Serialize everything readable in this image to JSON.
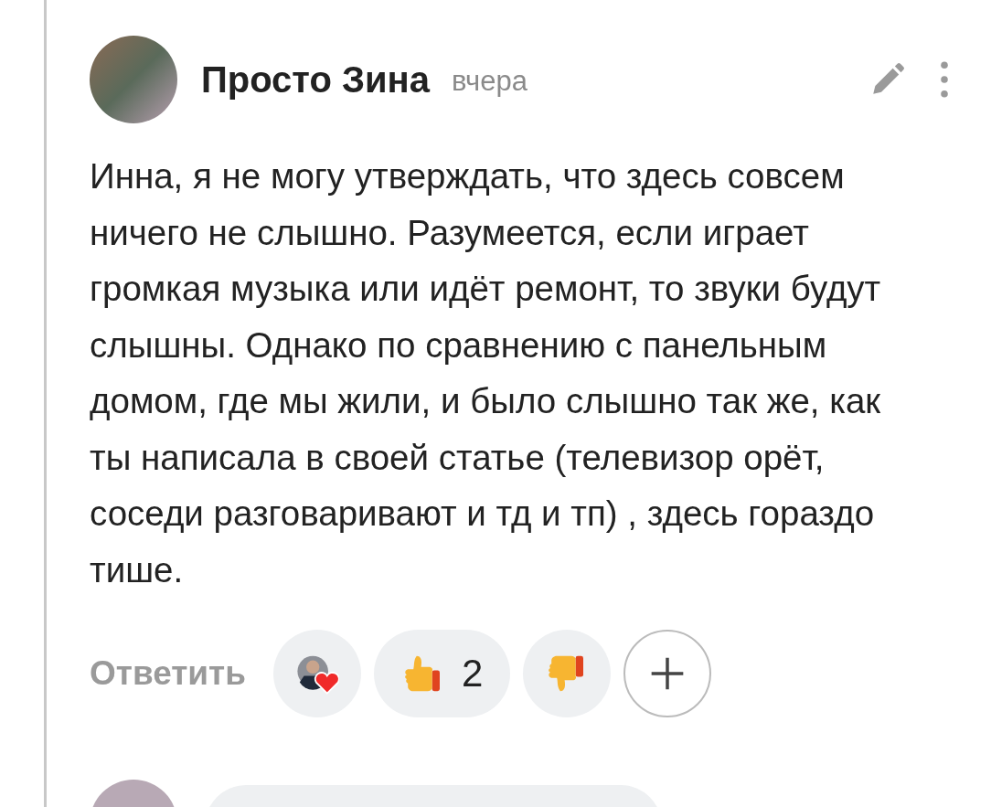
{
  "comment": {
    "author": "Просто Зина",
    "time": "вчера",
    "text": "Инна, я не могу утверждать, что здесь совсем ничего не слышно. Разумеется, если играет громкая музыка или идёт ремонт, то звуки будут слышны. Однако по сравнению с панельным домом, где мы жили, и было слышно так же, как ты написала в своей статье (телевизор орёт, соседи разговаривают и тд и тп) , здесь гораздо тише.",
    "reply": "Ответить",
    "reactions": [
      {
        "kind": "avatar-heart"
      },
      {
        "kind": "like",
        "count": "2"
      },
      {
        "kind": "dislike"
      },
      {
        "kind": "add"
      }
    ]
  }
}
